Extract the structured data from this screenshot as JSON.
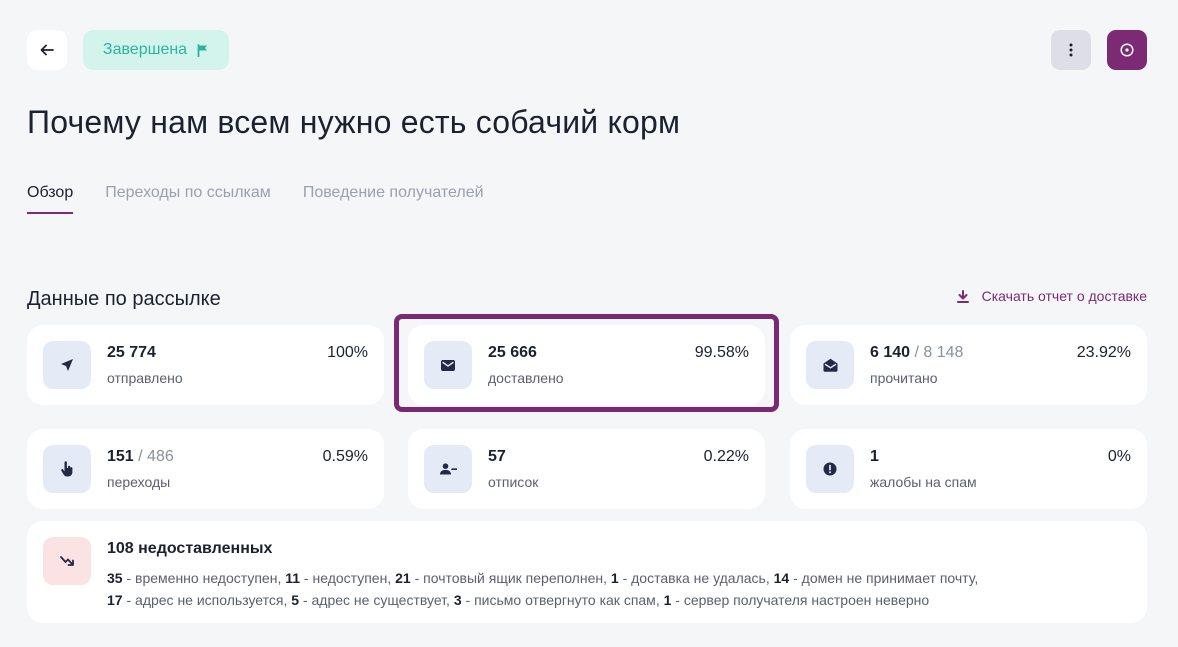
{
  "header": {
    "status": "Завершена",
    "colors": {
      "accent": "#7b2a73",
      "status_bg": "#d3f4ec",
      "status_text": "#2bb59a"
    }
  },
  "title": "Почему нам всем нужно есть собачий корм",
  "tabs": [
    {
      "label": "Обзор",
      "active": true
    },
    {
      "label": "Переходы по ссылкам",
      "active": false
    },
    {
      "label": "Поведение получателей",
      "active": false
    }
  ],
  "section": {
    "title": "Данные по рассылке",
    "download_label": "Скачать отчет о доставке"
  },
  "stats": {
    "sent": {
      "value": "25 774",
      "label": "отправлено",
      "percent": "100%",
      "icon": "send-icon"
    },
    "delivered": {
      "value": "25 666",
      "label": "доставлено",
      "percent": "99.58%",
      "icon": "envelope-icon"
    },
    "read": {
      "value": "6 140",
      "total": "8 148",
      "label": "прочитано",
      "percent": "23.92%",
      "icon": "open-envelope-icon"
    },
    "clicks": {
      "value": "151",
      "total": "486",
      "label": "переходы",
      "percent": "0.59%",
      "icon": "pointer-hand-icon"
    },
    "unsubscribes": {
      "value": "57",
      "label": "отписок",
      "percent": "0.22%",
      "icon": "user-minus-icon"
    },
    "spam": {
      "value": "1",
      "label": "жалобы на спам",
      "percent": "0%",
      "icon": "alert-icon"
    }
  },
  "undelivered": {
    "title": "108 недоставленных",
    "items": [
      {
        "count": "35",
        "text": "временно недоступен"
      },
      {
        "count": "11",
        "text": "недоступен"
      },
      {
        "count": "21",
        "text": "почтовый ящик переполнен"
      },
      {
        "count": "1",
        "text": "доставка не удалась"
      },
      {
        "count": "14",
        "text": "домен не принимает почту"
      },
      {
        "count": "17",
        "text": "адрес не используется"
      },
      {
        "count": "5",
        "text": "адрес не существует"
      },
      {
        "count": "3",
        "text": "письмо отвергнуто как спам"
      },
      {
        "count": "1",
        "text": "сервер получателя настроен неверно"
      }
    ]
  }
}
